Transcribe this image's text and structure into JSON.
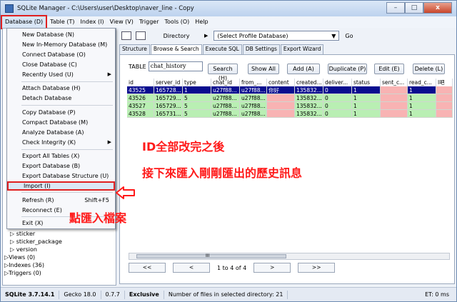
{
  "window": {
    "title": "SQLite Manager - C:\\Users\\user\\Desktop\\naver_line - Copy",
    "minimize": "–",
    "maximize": "□",
    "close": "x"
  },
  "menubar": [
    "Database (D)",
    "Table (T)",
    "Index (I)",
    "View (V)",
    "Trigger",
    "Tools (O)",
    "Help"
  ],
  "toolbar": {
    "directory_label": "Directory",
    "profile_select": "(Select Profile Database)",
    "go_label": "Go"
  },
  "tabs": [
    "Structure",
    "Browse & Search",
    "Execute SQL",
    "DB Settings",
    "Export Wizard"
  ],
  "browse": {
    "table_label": "TABLE",
    "table_value": "chat_history",
    "buttons": [
      "Search (H)",
      "Show All",
      "Add (A)",
      "Duplicate (P)",
      "Edit (E)",
      "Delete (L)"
    ],
    "columns": [
      "id",
      "server_id",
      "type",
      "chat_id",
      "from_...",
      "content",
      "created...",
      "deliver...",
      "status",
      "sent_c...",
      "read_c...",
      "l吧"
    ],
    "rows": [
      [
        "43525",
        "165728...",
        "1",
        "u27f88...",
        "u27f88...",
        "你好",
        "135832...",
        "0",
        "1",
        "",
        "1",
        ""
      ],
      [
        "43526",
        "165729...",
        "5",
        "u27f88...",
        "u27f88...",
        "",
        "135832...",
        "0",
        "1",
        "",
        "1",
        ""
      ],
      [
        "43527",
        "165729...",
        "5",
        "u27f88...",
        "u27f88...",
        "",
        "135832...",
        "0",
        "1",
        "",
        "1",
        ""
      ],
      [
        "43528",
        "165731...",
        "5",
        "u27f88...",
        "u27f88...",
        "",
        "135832...",
        "0",
        "1",
        "",
        "1",
        ""
      ]
    ],
    "scroll_mark": "III",
    "pager": {
      "first": "<<",
      "prev": "<",
      "label_a": "1",
      "to": "to",
      "label_b": "4",
      "of": "of",
      "total": "4",
      "next": ">",
      "last": ">>"
    }
  },
  "database_menu": [
    {
      "label": "New Database (N)"
    },
    {
      "label": "New In-Memory Database (M)"
    },
    {
      "label": "Connect Database (O)"
    },
    {
      "label": "Close Database (C)"
    },
    {
      "label": "Recently Used (U)",
      "submenu": "▶"
    },
    {
      "label": "Attach Database (H)"
    },
    {
      "label": "Detach Database"
    },
    {
      "label": "Copy Database (P)"
    },
    {
      "label": "Compact Database (M)"
    },
    {
      "label": "Analyze Database (A)"
    },
    {
      "label": "Check Integrity (K)",
      "submenu": "▶"
    },
    {
      "label": "Export All Tables (X)"
    },
    {
      "label": "Export Database (B)"
    },
    {
      "label": "Export Database Structure (U)"
    },
    {
      "label": "Import (I)"
    },
    {
      "label": "Refresh (R)",
      "shortcut": "Shift+F5"
    },
    {
      "label": "Reconnect (E)"
    },
    {
      "label": "Exit (X)"
    }
  ],
  "tree": [
    "▷ sticker",
    "▷ sticker_package",
    "▷ version",
    "▷Views (0)",
    "▷Indexes (36)",
    "▷Triggers (0)"
  ],
  "annotations": {
    "line1": "ID全部改完之後",
    "line2": "接下來匯入剛剛匯出的歷史訊息",
    "import_hint": "點匯入檔案"
  },
  "statusbar": {
    "version": "SQLite 3.7.14.1",
    "gecko": "Gecko 18.0",
    "ext": "0.7.7",
    "mode": "Exclusive",
    "files": "Number of files in selected directory: 21",
    "et": "ET: 0 ms"
  },
  "colors": {
    "selected_row": "#090d8f",
    "new_row": "#b9efb3",
    "null_cell": "#f8b3b3",
    "annotation": "#ff1a1a"
  }
}
